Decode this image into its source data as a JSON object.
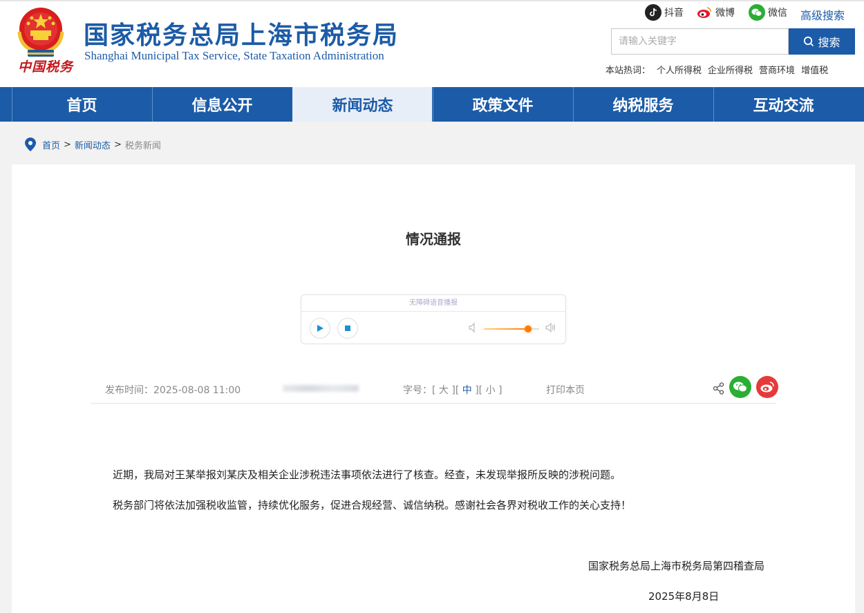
{
  "header": {
    "site_title": "国家税务总局上海市税务局",
    "site_subtitle": "Shanghai Municipal Tax Service, State Taxation Administration",
    "brand_script": "中国税务",
    "social": [
      {
        "label": "抖音",
        "icon": "tiktok-icon"
      },
      {
        "label": "微博",
        "icon": "weibo-icon"
      },
      {
        "label": "微信",
        "icon": "wechat-icon"
      }
    ],
    "advanced_search": "高级搜索",
    "search": {
      "placeholder": "请输入关键字",
      "value": "",
      "button": "搜索"
    },
    "hot": {
      "label": "本站热词：",
      "items": [
        "个人所得税",
        "企业所得税",
        "营商环境",
        "增值税"
      ]
    }
  },
  "nav": {
    "items": [
      "首页",
      "信息公开",
      "新闻动态",
      "政策文件",
      "纳税服务",
      "互动交流"
    ],
    "active_index": 2
  },
  "breadcrumb": {
    "items": [
      "首页",
      "新闻动态"
    ],
    "separator": ">",
    "current": "税务新闻"
  },
  "article": {
    "title": "情况通报",
    "player": {
      "label": "无障碍语音播报",
      "volume": 0.8
    },
    "meta": {
      "publish": "发布时间：2025-08-08 11:00",
      "fontsize_label": "字号：",
      "fontsizes": [
        "大",
        "中",
        "小"
      ],
      "fontsize_selected": "中",
      "print": "打印本页"
    },
    "paragraphs": [
      "近期，我局对王某举报刘某庆及相关企业涉税违法事项依法进行了核查。经查，未发现举报所反映的涉税问题。",
      "税务部门将依法加强税收监管，持续优化服务，促进合规经营、诚信纳税。感谢社会各界对税收工作的关心支持！"
    ],
    "signer": "国家税务总局上海市税务局第四稽查局",
    "date": "2025年8月8日"
  },
  "colors": {
    "primary": "#1c5ba7",
    "nav_active_bg": "#e8eef8",
    "emblem_red": "#c4161c",
    "wechat_green": "#2aae34",
    "weibo_red": "#e53a3a"
  }
}
